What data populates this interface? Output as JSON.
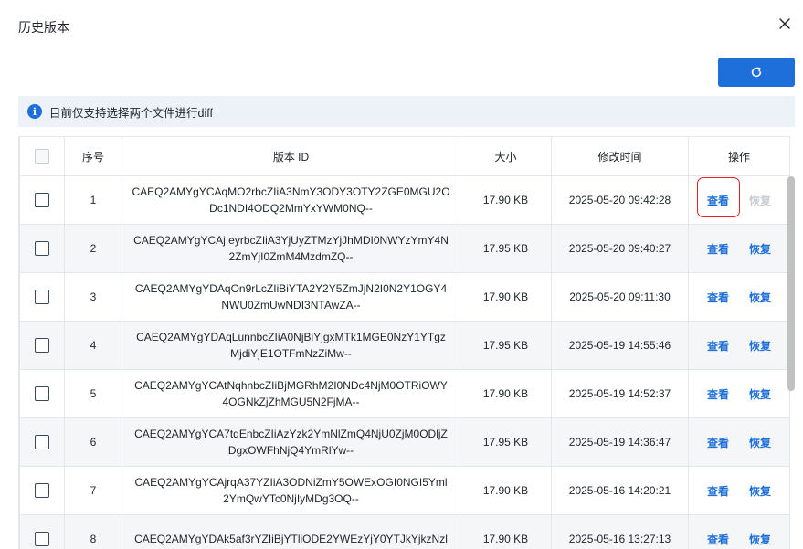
{
  "dialog": {
    "title": "历史版本",
    "info_text": "目前仅支持选择两个文件进行diff",
    "info_icon": "i"
  },
  "colors": {
    "primary": "#1e6fd9",
    "highlight": "#e0242a"
  },
  "table": {
    "headers": {
      "index": "序号",
      "version_id": "版本 ID",
      "size": "大小",
      "modified": "修改时间",
      "actions": "操作"
    },
    "rows": [
      {
        "index": "1",
        "id_line1": "CAEQ2AMYgYCAqMO2rbcZIiA3NmY3ODY3OTY2ZGE0MGU2O",
        "id_line2": "Dc1NDI4ODQ2MmYxYWM0NQ--",
        "size": "17.90 KB",
        "time": "2025-05-20 09:42:28",
        "view": "查看",
        "restore": "恢复",
        "restore_disabled": true
      },
      {
        "index": "2",
        "id_line1": "CAEQ2AMYgYCAj.eyrbcZIiA3YjUyZTMzYjJhMDI0NWYzYmY4N",
        "id_line2": "2ZmYjI0ZmM4MzdmZQ--",
        "size": "17.95 KB",
        "time": "2025-05-20 09:40:27",
        "view": "查看",
        "restore": "恢复",
        "restore_disabled": false
      },
      {
        "index": "3",
        "id_line1": "CAEQ2AMYgYDAqOn9rLcZIiBiYTA2Y2Y5ZmJjN2I0N2Y1OGY4",
        "id_line2": "NWU0ZmUwNDI3NTAwZA--",
        "size": "17.90 KB",
        "time": "2025-05-20 09:11:30",
        "view": "查看",
        "restore": "恢复",
        "restore_disabled": false
      },
      {
        "index": "4",
        "id_line1": "CAEQ2AMYgYDAqLunnbcZIiA0NjBiYjgxMTk1MGE0NzY1YTgz",
        "id_line2": "MjdiYjE1OTFmNzZiMw--",
        "size": "17.95 KB",
        "time": "2025-05-19 14:55:46",
        "view": "查看",
        "restore": "恢复",
        "restore_disabled": false
      },
      {
        "index": "5",
        "id_line1": "CAEQ2AMYgYCAtNqhnbcZIiBjMGRhM2I0NDc4NjM0OTRiOWY",
        "id_line2": "4OGNkZjZhMGU5N2FjMA--",
        "size": "17.90 KB",
        "time": "2025-05-19 14:52:37",
        "view": "查看",
        "restore": "恢复",
        "restore_disabled": false
      },
      {
        "index": "6",
        "id_line1": "CAEQ2AMYgYCA7tqEnbcZIiAzYzk2YmNlZmQ4NjU0ZjM0ODljZ",
        "id_line2": "DgxOWFhNjQ4YmRlYw--",
        "size": "17.95 KB",
        "time": "2025-05-19 14:36:47",
        "view": "查看",
        "restore": "恢复",
        "restore_disabled": false
      },
      {
        "index": "7",
        "id_line1": "CAEQ2AMYgYCAjrqA37YZIiA3ODNiZmY5OWExOGI0NGI5Yml",
        "id_line2": "2YmQwYTc0NjIyMDg3OQ--",
        "size": "17.90 KB",
        "time": "2025-05-16 14:20:21",
        "view": "查看",
        "restore": "恢复",
        "restore_disabled": false
      },
      {
        "index": "8",
        "id_line1": "CAEQ2AMYgYDAk5af3rYZIiBjYTliODE2YWEzYjY0YTJkYjkzNzl",
        "id_line2": "",
        "size": "17.90 KB",
        "time": "2025-05-16 13:27:13",
        "view": "查看",
        "restore": "恢复",
        "restore_disabled": false
      }
    ]
  }
}
